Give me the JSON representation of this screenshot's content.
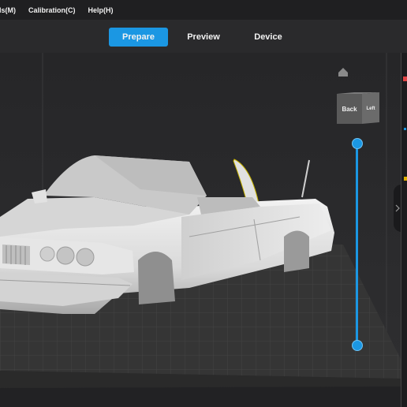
{
  "menubar": {
    "items": [
      {
        "label": "els(M)"
      },
      {
        "label": "Calibration(C)"
      },
      {
        "label": "Help(H)"
      }
    ]
  },
  "tabs": [
    {
      "label": "Prepare",
      "active": true
    },
    {
      "label": "Preview",
      "active": false
    },
    {
      "label": "Device",
      "active": false
    }
  ],
  "viewcube": {
    "front_label": "Back",
    "side_label": "Left"
  },
  "layer_slider": {
    "upper_fraction": 1.0,
    "lower_fraction": 0.0
  },
  "icons": {
    "home": "home-icon",
    "collapse": "chevron-right-icon"
  },
  "colors": {
    "accent": "#1b97e3",
    "background": "#2c2c2e",
    "plate": "#3a3a3a",
    "model": "#e8e8e8"
  }
}
